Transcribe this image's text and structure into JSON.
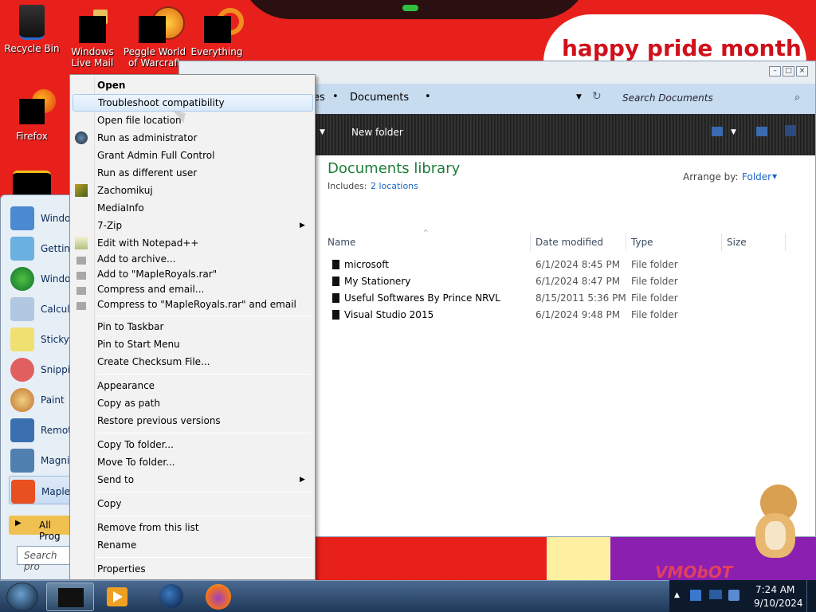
{
  "wallpaper": {
    "banner": "happy pride month",
    "bottom_text": "VMObOT"
  },
  "desktop_icons": [
    {
      "label": "Recycle Bin",
      "icon": "recycle-bin-icon"
    },
    {
      "label": "Windows Live Mail",
      "icon": "windows-live-mail-icon"
    },
    {
      "label": "Peggle World of Warcraft",
      "icon": "peggle-icon"
    },
    {
      "label": "Everything",
      "icon": "everything-search-icon"
    },
    {
      "label": "Firefox",
      "icon": "firefox-icon"
    }
  ],
  "explorer": {
    "breadcrumb_tail": "es",
    "breadcrumb_current": "Documents",
    "search_placeholder": "Search Documents",
    "new_folder": "New folder",
    "library_title": "Documents library",
    "includes_label": "Includes:",
    "includes_link": "2 locations",
    "arrange_label": "Arrange by:",
    "arrange_value": "Folder",
    "columns": {
      "name": "Name",
      "date": "Date modified",
      "type": "Type",
      "size": "Size"
    },
    "files": [
      {
        "name": "microsoft",
        "date": "6/1/2024 8:45 PM",
        "type": "File folder"
      },
      {
        "name": "My Stationery",
        "date": "6/1/2024 8:47 PM",
        "type": "File folder"
      },
      {
        "name": "Useful Softwares By Prince NRVL",
        "date": "8/15/2011 5:36 PM",
        "type": "File folder"
      },
      {
        "name": "Visual Studio 2015",
        "date": "6/1/2024 9:48 PM",
        "type": "File folder"
      }
    ]
  },
  "start_menu": {
    "items": [
      {
        "label": "Windo",
        "icon": "windows-media-center-icon"
      },
      {
        "label": "Getting",
        "icon": "getting-started-icon"
      },
      {
        "label": "Windo",
        "icon": "windows-orb-icon"
      },
      {
        "label": "Calcula",
        "icon": "calculator-icon"
      },
      {
        "label": "Sticky",
        "icon": "sticky-notes-icon"
      },
      {
        "label": "Snippi",
        "icon": "snipping-tool-icon"
      },
      {
        "label": "Paint",
        "icon": "paint-icon"
      },
      {
        "label": "Remot",
        "icon": "remote-desktop-icon"
      },
      {
        "label": "Magni",
        "icon": "magnifier-icon"
      },
      {
        "label": "Maple",
        "icon": "maple-leaf-icon"
      }
    ],
    "all_programs": "All Prog",
    "search_placeholder": "Search pro"
  },
  "context_menu": {
    "items": [
      {
        "label": "Open",
        "bold": true
      },
      {
        "label": "Troubleshoot compatibility",
        "highlighted": true
      },
      {
        "label": "Open file location"
      },
      {
        "label": "Run as administrator",
        "icon": "shield-icon"
      },
      {
        "label": "Grant Admin Full Control"
      },
      {
        "label": "Run as different user"
      },
      {
        "label": "Zachomikuj",
        "icon": "zachomikuj-icon"
      },
      {
        "label": "MediaInfo"
      },
      {
        "label": "7-Zip",
        "submenu": true
      },
      {
        "label": "Edit with Notepad++",
        "icon": "notepad-plus-plus-icon"
      },
      {
        "label": "Add to archive...",
        "icon": "winrar-icon"
      },
      {
        "label": "Add to \"MapleRoyals.rar\"",
        "icon": "winrar-icon"
      },
      {
        "label": "Compress and email...",
        "icon": "winrar-icon"
      },
      {
        "label": "Compress to \"MapleRoyals.rar\" and email",
        "icon": "winrar-icon"
      },
      {
        "label": "Pin to Taskbar"
      },
      {
        "label": "Pin to Start Menu"
      },
      {
        "label": "Create Checksum File..."
      },
      {
        "label": "Appearance"
      },
      {
        "label": "Copy as path"
      },
      {
        "label": "Restore previous versions"
      },
      {
        "label": "Copy To folder..."
      },
      {
        "label": "Move To folder..."
      },
      {
        "label": "Send to",
        "submenu": true
      },
      {
        "label": "Copy"
      },
      {
        "label": "Remove from this list"
      },
      {
        "label": "Rename"
      },
      {
        "label": "Properties"
      }
    ]
  },
  "taskbar": {
    "time": "7:24 AM",
    "date": "9/10/2024",
    "pinned": [
      "black-app-icon",
      "media-player-icon",
      "globe-icon",
      "firefox-icon"
    ]
  },
  "colors": {
    "wallpaper_red": "#e8201c",
    "link_blue": "#1a66c6",
    "title_green": "#1e7d3a",
    "taskbar": "#1e3858"
  }
}
